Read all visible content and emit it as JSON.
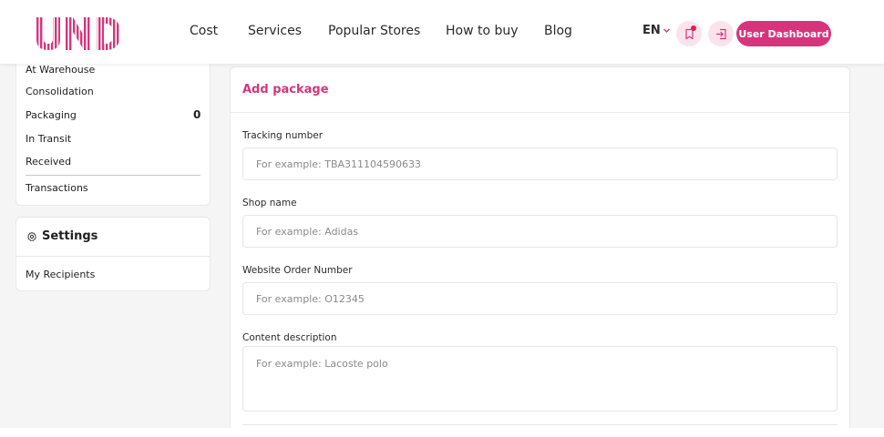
{
  "header": {
    "logo_text": "UND",
    "nav": [
      "Cost",
      "Services",
      "Popular Stores",
      "How to buy",
      "Blog"
    ],
    "language": "EN",
    "dashboard_label": "User Dashboard",
    "icons": [
      "notification-icon",
      "login-icon"
    ]
  },
  "sidebar": {
    "items": [
      {
        "label": "At Warehouse"
      },
      {
        "label": "Consolidation"
      },
      {
        "label": "Packaging",
        "count": "0"
      },
      {
        "label": "In Transit"
      },
      {
        "label": "Received"
      },
      {
        "label": "Transactions"
      }
    ],
    "settings": {
      "title": "Settings",
      "icon": "gear-icon",
      "items": [
        {
          "label": "My Recipients"
        }
      ]
    }
  },
  "form": {
    "title": "Add package",
    "fields": [
      {
        "label": "Tracking number",
        "placeholder": "For example: TBA311104590633"
      },
      {
        "label": "Shop name",
        "placeholder": "For example: Adidas"
      },
      {
        "label": "Website Order Number",
        "placeholder": "For example: O12345"
      },
      {
        "label": "Content description",
        "placeholder": "For example: Lacoste polo"
      }
    ]
  },
  "colors": {
    "accent": "#d6357c",
    "accent_light": "#fbe3ec",
    "background": "#f5f5f5"
  }
}
